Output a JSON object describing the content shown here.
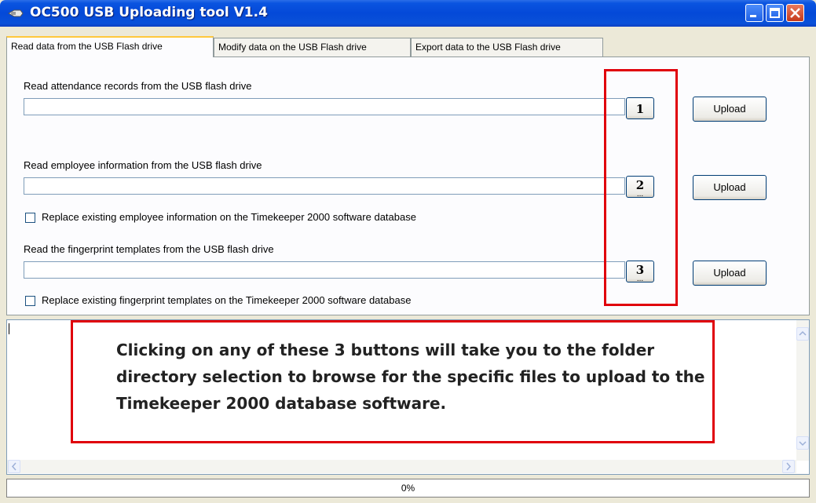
{
  "window": {
    "title": "OC500 USB Uploading tool V1.4",
    "icon": "usb-icon",
    "controls": [
      "minimize-icon",
      "maximize-icon",
      "close-icon"
    ]
  },
  "tabs": [
    {
      "label": "Read data from the USB Flash drive",
      "active": true
    },
    {
      "label": "Modify data on the USB Flash drive",
      "active": false
    },
    {
      "label": "Export data to the USB Flash drive",
      "active": false
    }
  ],
  "sections": {
    "attendance": {
      "label": "Read attendance records from the USB flash drive",
      "value": "",
      "browse_number": "1",
      "upload_label": "Upload"
    },
    "employee": {
      "label": "Read employee information from the USB flash drive",
      "value": "",
      "browse_number": "2",
      "browse_dots": "...",
      "upload_label": "Upload",
      "checkbox_label": "Replace existing employee information on the Timekeeper 2000 software database",
      "checked": false
    },
    "fingerprint": {
      "label": "Read the fingerprint templates from the USB flash drive",
      "value": "",
      "browse_number": "3",
      "browse_dots": "...",
      "upload_label": "Upload",
      "checkbox_label": "Replace existing fingerprint templates on the Timekeeper 2000 software database",
      "checked": false
    }
  },
  "callout": {
    "text": "Clicking on any of these 3 buttons will take you to the folder directory selection to browse for the specific files to upload to the Timekeeper 2000 database software.",
    "border_color": "#e0000a"
  },
  "status": {
    "progress_text": "0%",
    "progress_value": 0
  },
  "colors": {
    "titlebar": "#0449d8",
    "window_bg": "#ece9d8",
    "annotation_red": "#e0000a"
  }
}
